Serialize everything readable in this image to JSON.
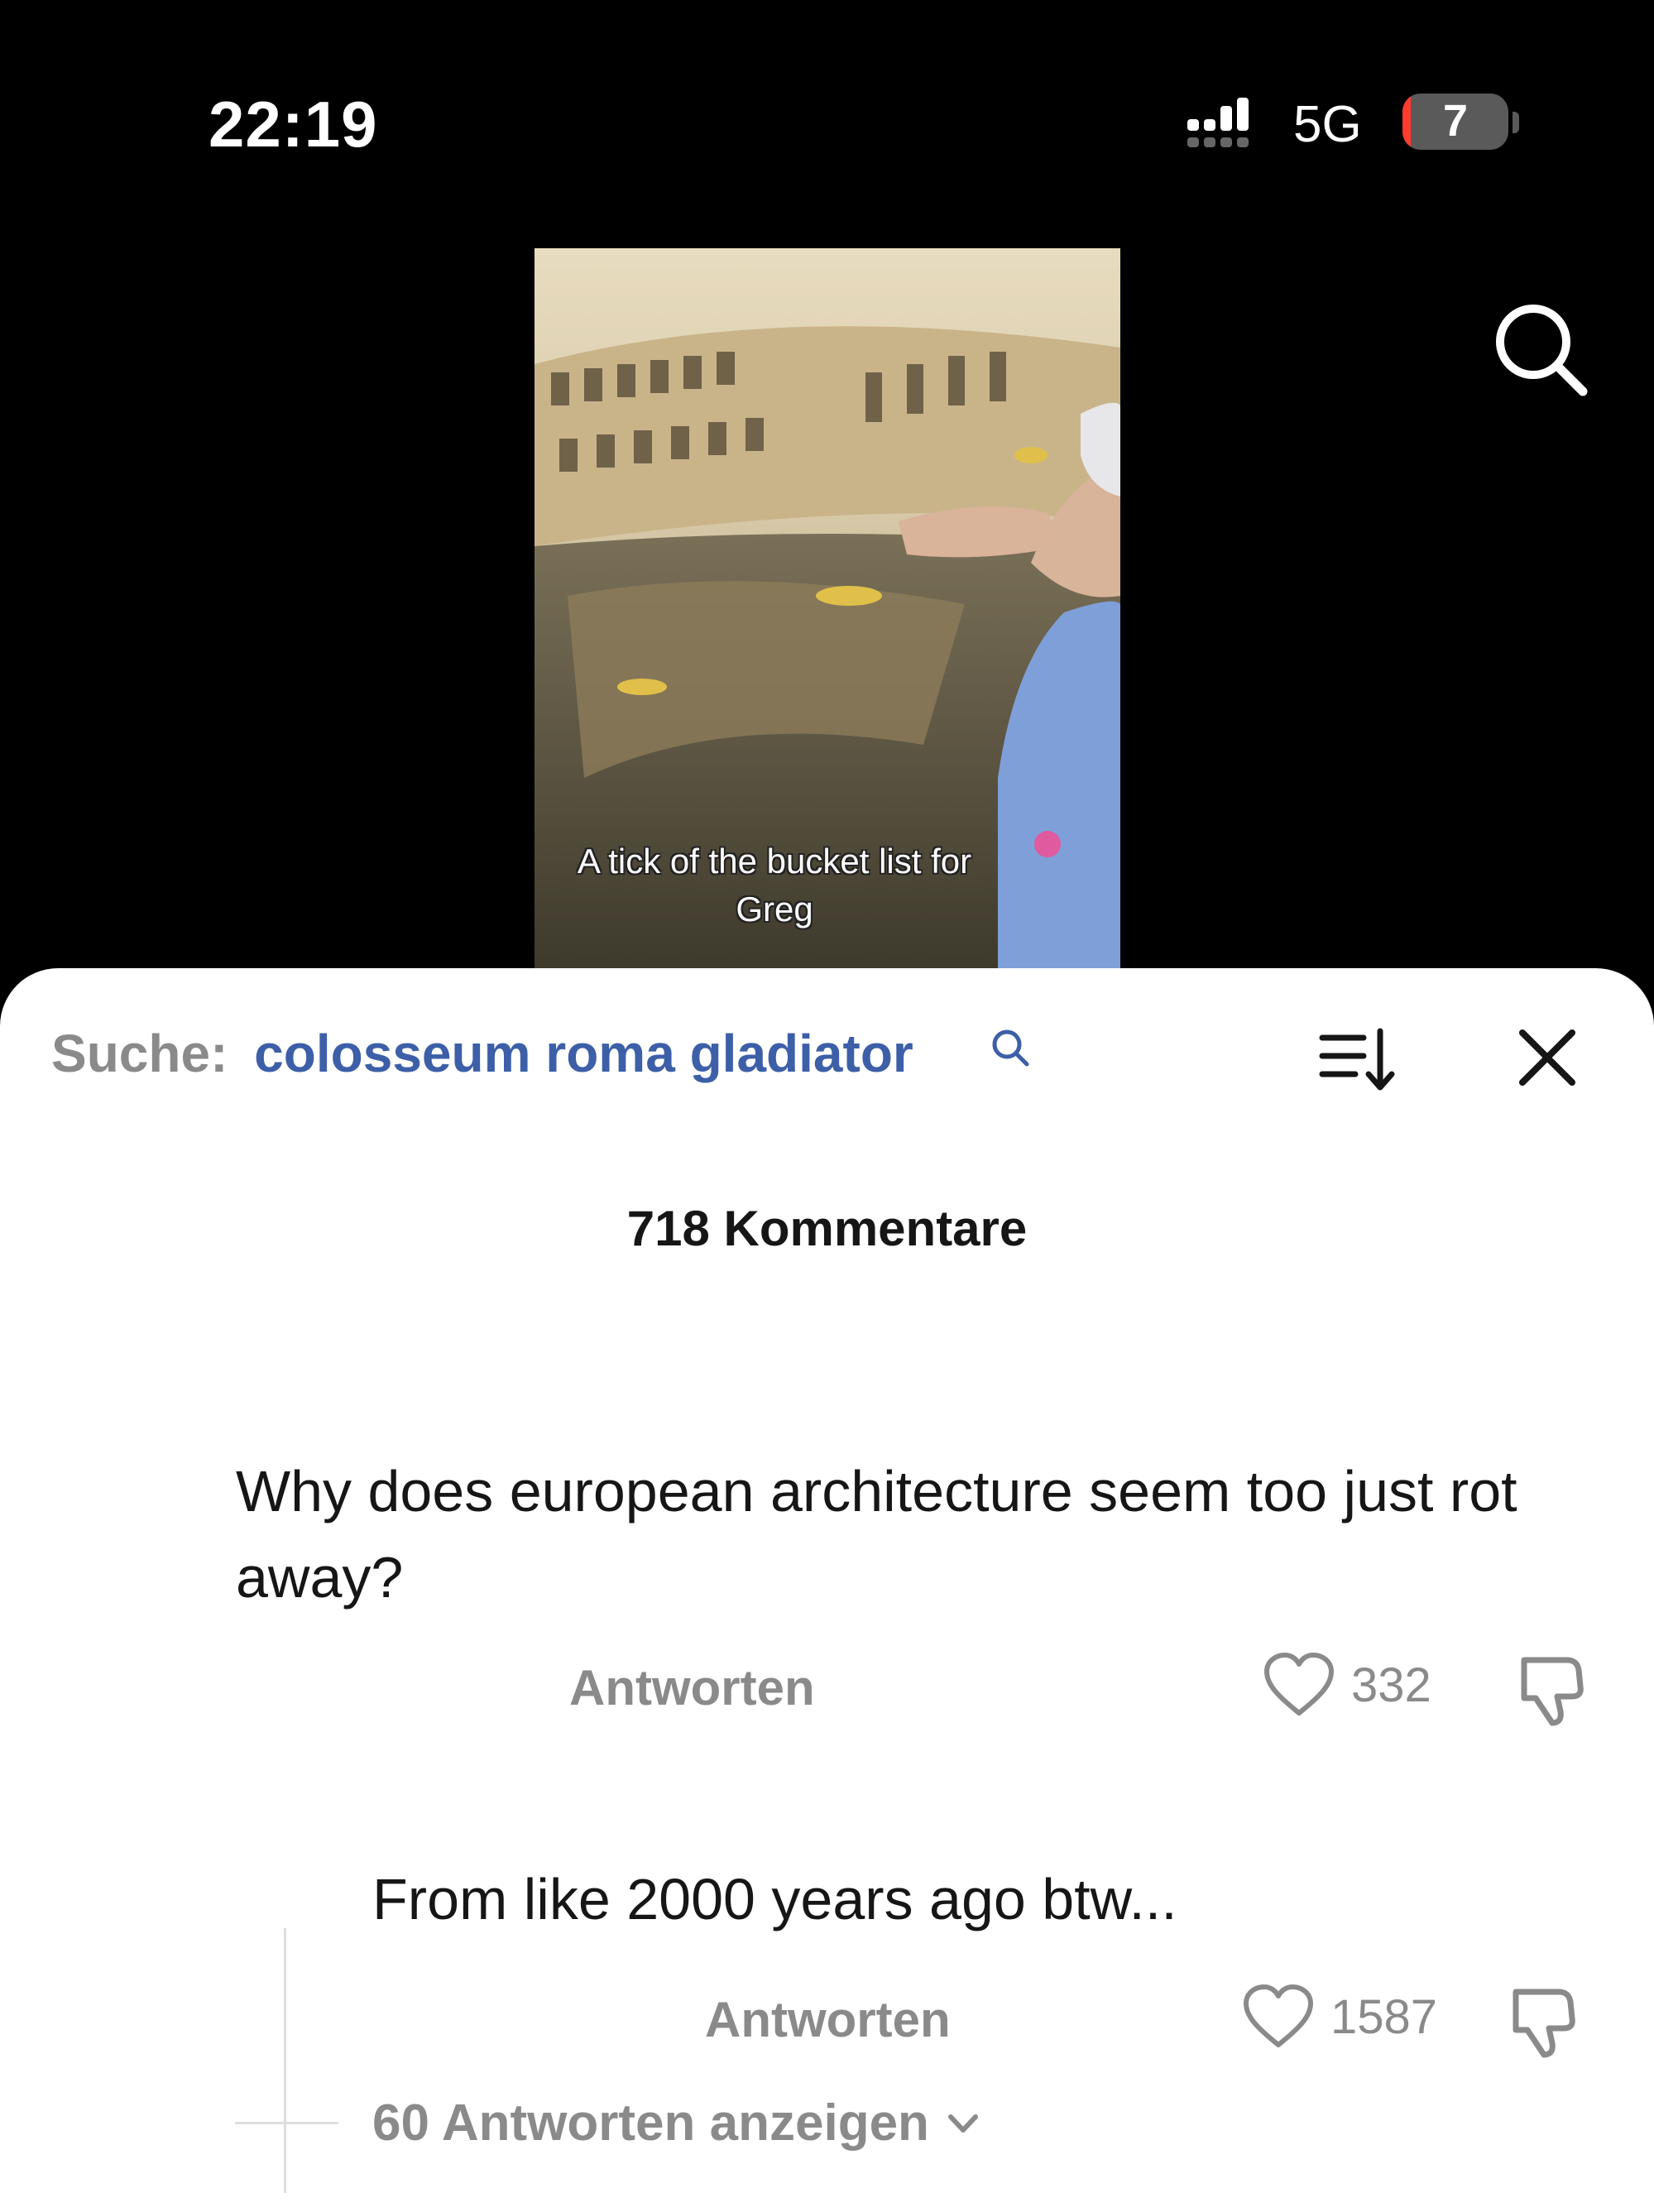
{
  "status_bar": {
    "time": "22:19",
    "network": "5G",
    "battery_level": "7",
    "battery_color": "#ff3b30"
  },
  "top_actions": {
    "search_icon": "search-icon"
  },
  "video": {
    "caption": "A tick of the bucket list for Greg"
  },
  "comments_sheet": {
    "search_label": "Suche:",
    "search_query": "colosseum roma gladiator",
    "query_color": "#3d5fa8",
    "sort_icon": "sort-icon",
    "close_icon": "close-icon",
    "comment_count": "718 Kommentare",
    "comments": [
      {
        "text": "Why does european architecture seem too just rot away?",
        "reply_label": "Antworten",
        "likes": "332"
      },
      {
        "text": "From like 2000 years ago btw...",
        "reply_label": "Antworten",
        "likes": "1587",
        "view_replies": "60 Antworten anzeigen"
      }
    ]
  }
}
